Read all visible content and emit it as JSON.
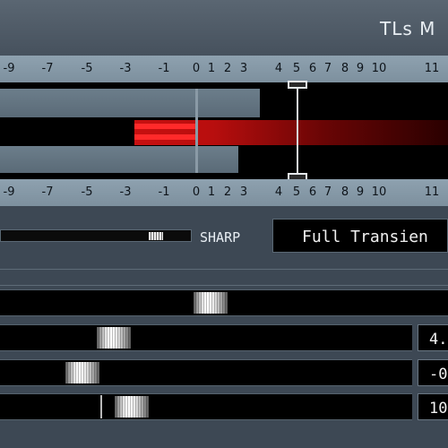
{
  "header": {
    "title": "TLs M"
  },
  "meter": {
    "scale_top": [
      "-9",
      "-7",
      "-5",
      "-3",
      "-1",
      "0",
      "1",
      "2",
      "3",
      "4",
      "5",
      "6",
      "7",
      "8",
      "9",
      "10",
      "11"
    ],
    "scale_bottom": [
      "-9",
      "-7",
      "-5",
      "-3",
      "-1",
      "0",
      "1",
      "2",
      "3",
      "4",
      "5",
      "6",
      "7",
      "8",
      "9",
      "10",
      "11"
    ]
  },
  "controls": {
    "sharp_label": "SHARP",
    "mode_value": "Full Transien"
  },
  "sliders": [
    {
      "value": ""
    },
    {
      "value": "4."
    },
    {
      "value": "-0"
    },
    {
      "value": "10"
    }
  ],
  "colors": {
    "panel": "#3d4854",
    "scale": "#8ea1af",
    "meter_red": "#ff2a2a",
    "text": "#e8eef3"
  }
}
